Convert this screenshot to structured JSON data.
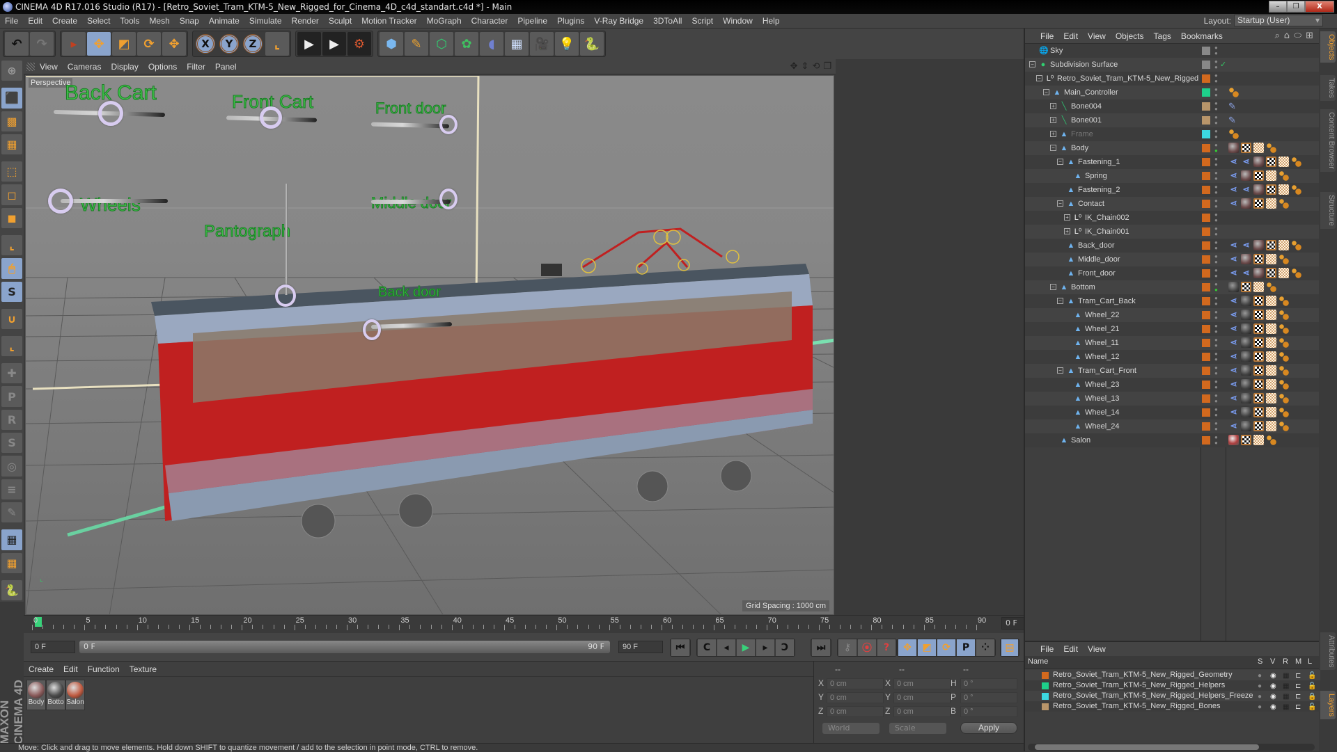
{
  "window": {
    "title": "CINEMA 4D R17.016 Studio (R17) - [Retro_Soviet_Tram_KTM-5_New_Rigged_for_Cinema_4D_c4d_standart.c4d *] - Main",
    "minimize": "–",
    "restore": "❐",
    "close": "X"
  },
  "menubar": {
    "items": [
      "File",
      "Edit",
      "Create",
      "Select",
      "Tools",
      "Mesh",
      "Snap",
      "Animate",
      "Simulate",
      "Render",
      "Sculpt",
      "Motion Tracker",
      "MoGraph",
      "Character",
      "Pipeline",
      "Plugins",
      "V-Ray Bridge",
      "3DToAll",
      "Script",
      "Window",
      "Help"
    ],
    "layout_label": "Layout:",
    "layout_value": "Startup (User)"
  },
  "toolbar": {
    "undo": "↶",
    "redo": "↷",
    "live_select": "▸",
    "move": "✥",
    "scale": "◩",
    "rotate": "⟳",
    "last_tool": "✥",
    "x_axis": "X",
    "y_axis": "Y",
    "z_axis": "Z",
    "coord_system": "⌞",
    "render_view": "▶",
    "render_picture": "▶",
    "render_settings": "⚙",
    "cube": "⬢",
    "pen": "✎",
    "subdivision": "⬡",
    "cloner": "✿",
    "deformer": "◖",
    "floor": "▦",
    "camera": "🎥",
    "light": "💡",
    "python": "🐍"
  },
  "left_toolbar": {
    "items": [
      {
        "name": "make-editable",
        "glyph": "⊕"
      },
      {
        "name": "model-mode",
        "glyph": "⬛"
      },
      {
        "name": "texture-mode",
        "glyph": "▩"
      },
      {
        "name": "workplane-mode",
        "glyph": "▦"
      },
      {
        "name": "points-mode",
        "glyph": "⬚"
      },
      {
        "name": "edges-mode",
        "glyph": "◻"
      },
      {
        "name": "polygons-mode",
        "glyph": "◼"
      },
      {
        "name": "axis-mode",
        "glyph": "⌞"
      },
      {
        "name": "tweak-mode",
        "glyph": "🖱"
      },
      {
        "name": "solo-mode",
        "glyph": "S"
      },
      {
        "name": "snap-toggle",
        "glyph": "∪"
      },
      {
        "name": "workplane-axis",
        "glyph": "⌞"
      },
      {
        "name": "add-joint",
        "glyph": "✚"
      },
      {
        "name": "bind-p",
        "glyph": "P"
      },
      {
        "name": "bind-r",
        "glyph": "R"
      },
      {
        "name": "bind-psr",
        "glyph": "S"
      },
      {
        "name": "weight-tool",
        "glyph": "◎"
      },
      {
        "name": "weight-manager",
        "glyph": "≡"
      },
      {
        "name": "paint-weights",
        "glyph": "✎"
      },
      {
        "name": "lock-workplane",
        "glyph": "▦"
      },
      {
        "name": "align-workplane",
        "glyph": "▦"
      },
      {
        "name": "python-script",
        "glyph": "🐍"
      }
    ]
  },
  "viewport": {
    "menu": [
      "View",
      "Cameras",
      "Display",
      "Options",
      "Filter",
      "Panel"
    ],
    "camera_label": "Perspective",
    "grid_spacing": "Grid Spacing : 1000 cm",
    "controllers": [
      {
        "label": "Back Cart"
      },
      {
        "label": "Front Cart"
      },
      {
        "label": "Front door"
      },
      {
        "label": "Wheels"
      },
      {
        "label": "Pantograph"
      },
      {
        "label": "Middle door"
      },
      {
        "label": "Back door"
      }
    ]
  },
  "timeline": {
    "ticks": [
      "0",
      "5",
      "10",
      "15",
      "20",
      "25",
      "30",
      "35",
      "40",
      "45",
      "50",
      "55",
      "60",
      "65",
      "70",
      "75",
      "80",
      "85",
      "90"
    ],
    "current_frame": "0 F",
    "start_field": "0 F",
    "range_start": "0 F",
    "range_end": "90 F",
    "end_field": "90 F"
  },
  "transport": {
    "goto_start": "⏮",
    "prev_key": "C",
    "prev_frame": "◂",
    "play": "▶",
    "next_frame": "▸",
    "next_key": "Ↄ",
    "goto_end": "⏭",
    "record": "⚷",
    "autokey": "⦿",
    "keyframe_selection": "?",
    "key_pos": "✥",
    "key_scale": "◩",
    "key_rot": "⟳",
    "key_param": "P",
    "key_pla": "⁘",
    "timeline_btn": "▤"
  },
  "material_manager": {
    "menu": [
      "Create",
      "Edit",
      "Function",
      "Texture"
    ],
    "materials": [
      {
        "name": "Body",
        "color": "#8a5a5a"
      },
      {
        "name": "Botto",
        "color": "#4a4a4a"
      },
      {
        "name": "Salon",
        "color": "#c05a40"
      }
    ]
  },
  "brand": "MAXON CINEMA 4D",
  "coordinates": {
    "headers": [
      "--",
      "--",
      "--"
    ],
    "position": [
      {
        "axis": "X",
        "value": "0 cm"
      },
      {
        "axis": "Y",
        "value": "0 cm"
      },
      {
        "axis": "Z",
        "value": "0 cm"
      }
    ],
    "size": [
      {
        "axis": "X",
        "value": "0 cm"
      },
      {
        "axis": "Y",
        "value": "0 cm"
      },
      {
        "axis": "Z",
        "value": "0 cm"
      }
    ],
    "rotation": [
      {
        "axis": "H",
        "value": "0 °"
      },
      {
        "axis": "P",
        "value": "0 °"
      },
      {
        "axis": "B",
        "value": "0 °"
      }
    ],
    "space_dropdown": "World",
    "mode_dropdown": "Scale",
    "apply_label": "Apply"
  },
  "status_bar": "Move: Click and drag to move elements. Hold down SHIFT to quantize movement / add to the selection in point mode, CTRL to remove.",
  "object_manager": {
    "menu": [
      "File",
      "Edit",
      "View",
      "Objects",
      "Tags",
      "Bookmarks"
    ],
    "objects": [
      {
        "name": "Sky",
        "depth": 0,
        "icon": "sky",
        "expander": "",
        "layer_color": "#888888",
        "tags": []
      },
      {
        "name": "Subdivision Surface",
        "depth": 0,
        "icon": "subdiv",
        "expander": "−",
        "layer_color": "#888888",
        "check": "✓",
        "tags": []
      },
      {
        "name": "Retro_Soviet_Tram_KTM-5_New_Rigged",
        "depth": 1,
        "icon": "null",
        "expander": "−",
        "layer_color": "#d2691e",
        "tags": []
      },
      {
        "name": "Main_Controller",
        "depth": 2,
        "icon": "joint",
        "expander": "−",
        "layer_color": "#1ecf8a",
        "tags": [
          "xp"
        ]
      },
      {
        "name": "Bone004",
        "depth": 3,
        "icon": "bone",
        "expander": "+",
        "layer_color": "#b8956a",
        "tags": [
          "bone"
        ]
      },
      {
        "name": "Bone001",
        "depth": 3,
        "icon": "bone",
        "expander": "+",
        "layer_color": "#b8956a",
        "tags": [
          "bone"
        ]
      },
      {
        "name": "Frame",
        "depth": 3,
        "icon": "joint",
        "expander": "+",
        "layer_color": "#3cd8e0",
        "dim": true,
        "tags": [
          "xp"
        ]
      },
      {
        "name": "Body",
        "depth": 3,
        "icon": "joint",
        "expander": "−",
        "layer_color": "#d2691e",
        "tags": [
          "mat1",
          "uv",
          "tex",
          "xp"
        ]
      },
      {
        "name": "Fastening_1",
        "depth": 4,
        "icon": "joint",
        "expander": "−",
        "layer_color": "#d2691e",
        "tags": [
          "ik",
          "ik",
          "mat1",
          "uv",
          "tex",
          "xp"
        ]
      },
      {
        "name": "Spring",
        "depth": 5,
        "icon": "joint",
        "expander": "",
        "layer_color": "#d2691e",
        "tags": [
          "ik",
          "mat1",
          "uv",
          "tex",
          "xp"
        ]
      },
      {
        "name": "Fastening_2",
        "depth": 4,
        "icon": "joint",
        "expander": "",
        "layer_color": "#d2691e",
        "tags": [
          "ik",
          "ik",
          "mat1",
          "uv",
          "tex",
          "xp"
        ]
      },
      {
        "name": "Contact",
        "depth": 4,
        "icon": "joint",
        "expander": "−",
        "layer_color": "#d2691e",
        "tags": [
          "ik",
          "mat1",
          "uv",
          "tex",
          "xp"
        ]
      },
      {
        "name": "IK_Chain002",
        "depth": 5,
        "icon": "null",
        "expander": "+",
        "layer_color": "#d2691e",
        "tags": []
      },
      {
        "name": "IK_Chain001",
        "depth": 5,
        "icon": "null",
        "expander": "+",
        "layer_color": "#d2691e",
        "tags": []
      },
      {
        "name": "Back_door",
        "depth": 4,
        "icon": "joint",
        "expander": "",
        "layer_color": "#d2691e",
        "tags": [
          "ik",
          "ik",
          "mat1",
          "uv",
          "tex",
          "xp"
        ]
      },
      {
        "name": "Middle_door",
        "depth": 4,
        "icon": "joint",
        "expander": "",
        "layer_color": "#d2691e",
        "tags": [
          "ik",
          "mat1",
          "uv",
          "tex",
          "xp"
        ]
      },
      {
        "name": "Front_door",
        "depth": 4,
        "icon": "joint",
        "expander": "",
        "layer_color": "#d2691e",
        "tags": [
          "ik",
          "ik",
          "mat1",
          "uv",
          "tex",
          "xp"
        ]
      },
      {
        "name": "Bottom",
        "depth": 3,
        "icon": "joint",
        "expander": "−",
        "layer_color": "#d2691e",
        "tags": [
          "mat2",
          "uv",
          "tex",
          "xp"
        ]
      },
      {
        "name": "Tram_Cart_Back",
        "depth": 4,
        "icon": "joint",
        "expander": "−",
        "layer_color": "#d2691e",
        "tags": [
          "ik",
          "mat2",
          "uv",
          "tex",
          "xp"
        ]
      },
      {
        "name": "Wheel_22",
        "depth": 5,
        "icon": "joint",
        "expander": "",
        "layer_color": "#d2691e",
        "tags": [
          "ik",
          "mat2",
          "uv",
          "tex",
          "xp"
        ]
      },
      {
        "name": "Wheel_21",
        "depth": 5,
        "icon": "joint",
        "expander": "",
        "layer_color": "#d2691e",
        "tags": [
          "ik",
          "mat2",
          "uv",
          "tex",
          "xp"
        ]
      },
      {
        "name": "Wheel_11",
        "depth": 5,
        "icon": "joint",
        "expander": "",
        "layer_color": "#d2691e",
        "tags": [
          "ik",
          "mat2",
          "uv",
          "tex",
          "xp"
        ]
      },
      {
        "name": "Wheel_12",
        "depth": 5,
        "icon": "joint",
        "expander": "",
        "layer_color": "#d2691e",
        "tags": [
          "ik",
          "mat2",
          "uv",
          "tex",
          "xp"
        ]
      },
      {
        "name": "Tram_Cart_Front",
        "depth": 4,
        "icon": "joint",
        "expander": "−",
        "layer_color": "#d2691e",
        "tags": [
          "ik",
          "mat2",
          "uv",
          "tex",
          "xp"
        ]
      },
      {
        "name": "Wheel_23",
        "depth": 5,
        "icon": "joint",
        "expander": "",
        "layer_color": "#d2691e",
        "tags": [
          "ik",
          "mat2",
          "uv",
          "tex",
          "xp"
        ]
      },
      {
        "name": "Wheel_13",
        "depth": 5,
        "icon": "joint",
        "expander": "",
        "layer_color": "#d2691e",
        "tags": [
          "ik",
          "mat2",
          "uv",
          "tex",
          "xp"
        ]
      },
      {
        "name": "Wheel_14",
        "depth": 5,
        "icon": "joint",
        "expander": "",
        "layer_color": "#d2691e",
        "tags": [
          "ik",
          "mat2",
          "uv",
          "tex",
          "xp"
        ]
      },
      {
        "name": "Wheel_24",
        "depth": 5,
        "icon": "joint",
        "expander": "",
        "layer_color": "#d2691e",
        "tags": [
          "ik",
          "mat2",
          "uv",
          "tex",
          "xp"
        ]
      },
      {
        "name": "Salon",
        "depth": 3,
        "icon": "joint",
        "expander": "",
        "layer_color": "#d2691e",
        "tags": [
          "mat3",
          "uv",
          "tex",
          "xp"
        ]
      }
    ]
  },
  "right_tabs": {
    "top": [
      {
        "label": "Objects",
        "active": true
      },
      {
        "label": "Takes"
      },
      {
        "label": "Content Browser"
      },
      {
        "label": "Structure"
      }
    ],
    "bottom": [
      {
        "label": "Attributes"
      },
      {
        "label": "Layers",
        "active": true
      }
    ]
  },
  "layer_manager": {
    "menu": [
      "File",
      "Edit",
      "View"
    ],
    "columns": [
      "Name",
      "S",
      "V",
      "R",
      "M",
      "L"
    ],
    "layers": [
      {
        "name": "Retro_Soviet_Tram_KTM-5_New_Rigged_Geometry",
        "color": "#d2691e",
        "locked": false
      },
      {
        "name": "Retro_Soviet_Tram_KTM-5_New_Rigged_Helpers",
        "color": "#1ecf8a",
        "locked": false
      },
      {
        "name": "Retro_Soviet_Tram_KTM-5_New_Rigged_Helpers_Freeze",
        "color": "#3cd8e0",
        "locked": true
      },
      {
        "name": "Retro_Soviet_Tram_KTM-5_New_Rigged_Bones",
        "color": "#b8956a",
        "locked": false
      }
    ]
  }
}
